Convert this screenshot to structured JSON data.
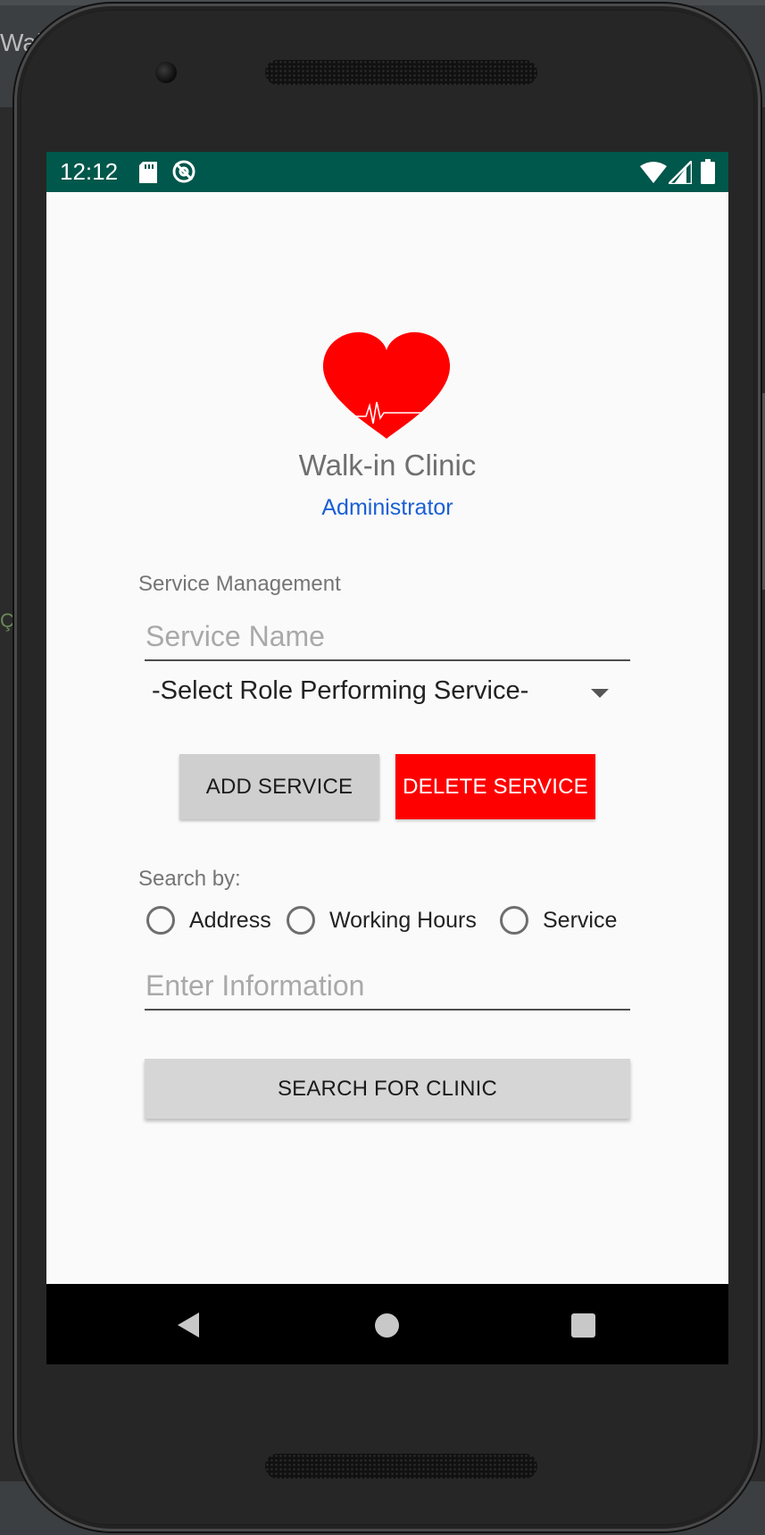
{
  "ide": {
    "title_fragment": "Wal",
    "side_fragment": "Ç"
  },
  "status_bar": {
    "time": "12:12",
    "icons": [
      "sd-card-icon",
      "sync-disabled-icon",
      "wifi-icon",
      "cell-signal-icon",
      "battery-icon"
    ],
    "background_color": "#00574b"
  },
  "app": {
    "logo_icon": "heart-pulse-icon",
    "title": "Walk-in Clinic",
    "subtitle": "Administrator"
  },
  "service_management": {
    "section_label": "Service Management",
    "service_name_placeholder": "Service Name",
    "role_spinner_selected": "-Select Role Performing Service-",
    "add_button_label": "ADD SERVICE",
    "delete_button_label": "DELETE SERVICE"
  },
  "search": {
    "section_label": "Search by:",
    "options": [
      {
        "label": "Address",
        "checked": false
      },
      {
        "label": "Working Hours",
        "checked": false
      },
      {
        "label": "Service",
        "checked": false
      }
    ],
    "input_placeholder": "Enter Information",
    "button_label": "SEARCH FOR CLINIC"
  },
  "colors": {
    "accent_blue": "#1a5fd6",
    "delete_red": "#ff0000",
    "logo_red": "#ff0000"
  },
  "nav_bar": {
    "buttons": [
      "back-icon",
      "home-icon",
      "recents-icon"
    ]
  }
}
